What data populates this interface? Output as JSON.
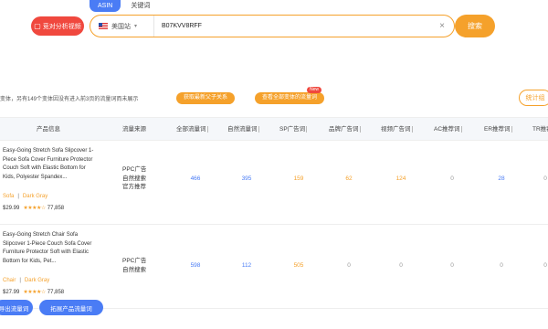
{
  "top_tabs": {
    "asin": "ASIN",
    "keyword": "关键词"
  },
  "search_bar": {
    "secondary_button": "竞对分析视频",
    "site": "美国站",
    "asin_value": "B07KVV8RFF",
    "search_button": "搜索"
  },
  "info_row": {
    "text": "变体，另有149个变体因没有进入前3页的流量词而未展示",
    "button_fetch": "获取最新父子关系",
    "button_view_all": "查看全部变体的流量词",
    "new_badge": "New",
    "stat_button": "统计组"
  },
  "table": {
    "headers": {
      "product": "产品信息",
      "source": "流量来源",
      "all_kw": "全部流量词",
      "natural": "自然流量词",
      "sp": "SP广告词",
      "brand": "品牌广告词",
      "video": "视频广告词",
      "ac": "AC推荐词",
      "er": "ER推荐词",
      "tr": "TR推荐"
    },
    "rows": [
      {
        "title": "Easy-Going Stretch Sofa Slipcover 1-Piece Sofa Cover Furniture Protector Couch Soft with Elastic Bottom for Kids, Polyester Spandex...",
        "variant_size": "Sofa",
        "variant_color": "Dark Gray",
        "price": "$29.99",
        "stars": "★★★★☆",
        "reviews": "77,858",
        "sources": [
          "PPC广告",
          "自然搜索",
          "官方推荐"
        ],
        "all_kw": "466",
        "natural": "395",
        "sp": "159",
        "brand": "62",
        "video": "124",
        "ac": "0",
        "er": "28",
        "tr": "0"
      },
      {
        "title": "Easy-Going Stretch Chair Sofa Slipcover 1-Piece Couch Sofa Cover Furniture Protector Soft with Elastic Bottom for Kids, Pet...",
        "variant_size": "Chair",
        "variant_color": "Dark Gray",
        "price": "$27.99",
        "stars": "★★★★☆",
        "reviews": "77,858",
        "sources": [
          "PPC广告",
          "自然搜索"
        ],
        "all_kw": "598",
        "natural": "112",
        "sp": "505",
        "brand": "0",
        "video": "0",
        "ac": "0",
        "er": "0",
        "tr": "0"
      }
    ]
  },
  "bottom_buttons": {
    "export_kw": "导出流量词",
    "expand_kw": "拓展产品流量词"
  },
  "colors": {
    "accent_orange": "#f5a12b",
    "primary_blue": "#4a7cf5",
    "red": "#f0483e"
  }
}
